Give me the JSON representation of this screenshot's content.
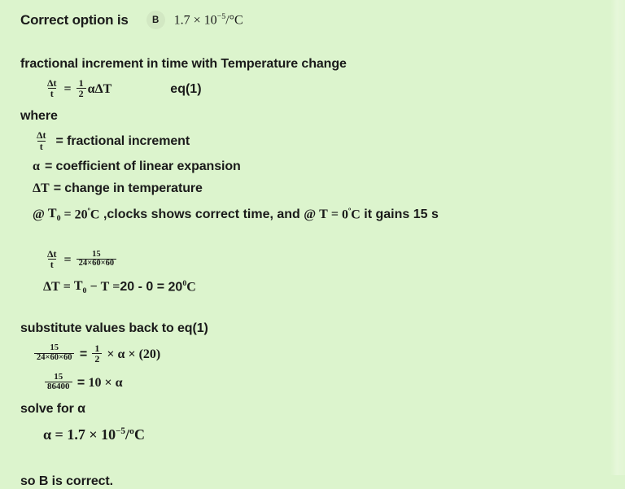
{
  "page": {
    "background_color": "#dcf4cd",
    "text_color": "#1a1a1a"
  },
  "header": {
    "title": "Correct option is",
    "badge_label": "B",
    "badge_color": "#d2e8c3",
    "answer_value": "1.7 × 10⁻⁵ /°C",
    "answer_mantissa": "1.7",
    "answer_times": "×",
    "answer_base": "10",
    "answer_exponent": "−5",
    "answer_unit": "/°C"
  },
  "body": {
    "intro": "fractional increment in time with Temperature change",
    "eq1": {
      "lhs_num": "Δt",
      "lhs_den": "t",
      "equals": "=",
      "coef_num": "1",
      "coef_den": "2",
      "alpha": "α",
      "deltaT": "ΔT",
      "tag": "eq(1)"
    },
    "where_label": "where",
    "definitions": [
      {
        "symbol_num": "Δt",
        "symbol_den": "t",
        "text": "= fractional increment"
      },
      {
        "symbol": "α",
        "text": "= coefficient of linear expansion"
      },
      {
        "symbol": "ΔT",
        "text": "= change in temperature"
      }
    ],
    "condition": {
      "at1": "@",
      "T0": "T",
      "T0_sub": "0",
      "eq1": "=",
      "val1": "20",
      "deg1": "º",
      "unit1": "C",
      "mid": ",clocks shows correct time, and",
      "at2": "@",
      "T": "T",
      "eq2": "=",
      "val2": "0",
      "deg2": "º",
      "unit2": "C",
      "tail": "it gains 15 s"
    },
    "calc": {
      "lhs_num": "Δt",
      "lhs_den": "t",
      "equals": "=",
      "rhs_num": "15",
      "rhs_den": "24×60×60"
    },
    "deltaT_line": {
      "deltaT": "ΔT",
      "eq1": "=",
      "T0": "T",
      "T0_sub": "0",
      "minus": "−",
      "T": "T",
      "eq2": "=",
      "values": "20 - 0",
      "eq3": "=",
      "result": "20",
      "result_exp": "0",
      "result_unit": "C"
    },
    "substitute_label": "substitute values back to eq(1)",
    "sub_eq1": {
      "lhs_num": "15",
      "lhs_den": "24×60×60",
      "equals": "=",
      "half_num": "1",
      "half_den": "2",
      "times1": "×",
      "alpha": "α",
      "times2": "×",
      "paren": "(20)"
    },
    "sub_eq2": {
      "lhs_num": "15",
      "lhs_den": "86400",
      "equals": "=",
      "ten": "10",
      "times": "×",
      "alpha": "α"
    },
    "solve_label": "solve for α",
    "alpha_result": {
      "alpha": "α",
      "equals": "=",
      "mantissa": "1.7",
      "times": "×",
      "base": "10",
      "exponent": "−5",
      "unit": "/ºC"
    },
    "conclusion": "so B is correct."
  }
}
